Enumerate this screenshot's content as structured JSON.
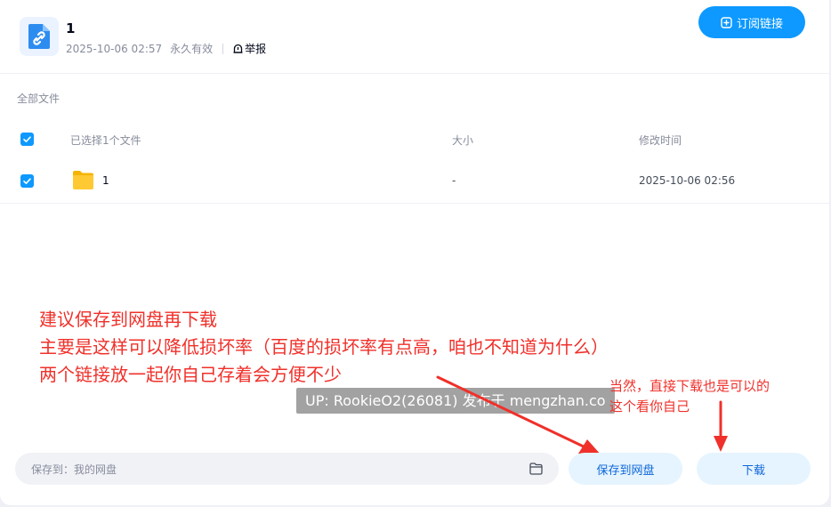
{
  "header": {
    "title": "1",
    "date": "2025-10-06 02:57",
    "validity": "永久有效",
    "report_label": "举报",
    "subscribe_label": "订阅链接"
  },
  "breadcrumb": "全部文件",
  "table": {
    "columns": [
      "已选择1个文件",
      "大小",
      "修改时间"
    ],
    "rows": [
      {
        "name": "1",
        "size": "-",
        "modified": "2025-10-06 02:56",
        "type": "folder",
        "checked": true
      }
    ]
  },
  "annotations": {
    "main_lines": [
      "建议保存到网盘再下载",
      "主要是这样可以降低损坏率（百度的损坏率有点高，咱也不知道为什么）",
      "两个链接放一起你自己存着会方便不少"
    ],
    "side_lines": [
      "当然，直接下载也是可以的",
      "这个看你自己"
    ],
    "watermark": "UP: RookieO2(26081) 发布于 mengzhan.co",
    "color": "#f0302a"
  },
  "bottom_bar": {
    "save_path": "保存到：我的网盘",
    "save_button": "保存到网盘",
    "download_button": "下载"
  },
  "colors": {
    "accent": "#0d99ff",
    "button_light": "#e6f4ff",
    "button_text": "#0d66d9"
  },
  "icons": [
    "link-icon",
    "report-icon",
    "subscribe-plus-icon",
    "checkbox-checked-icon",
    "folder-icon",
    "folder-outline-icon"
  ]
}
